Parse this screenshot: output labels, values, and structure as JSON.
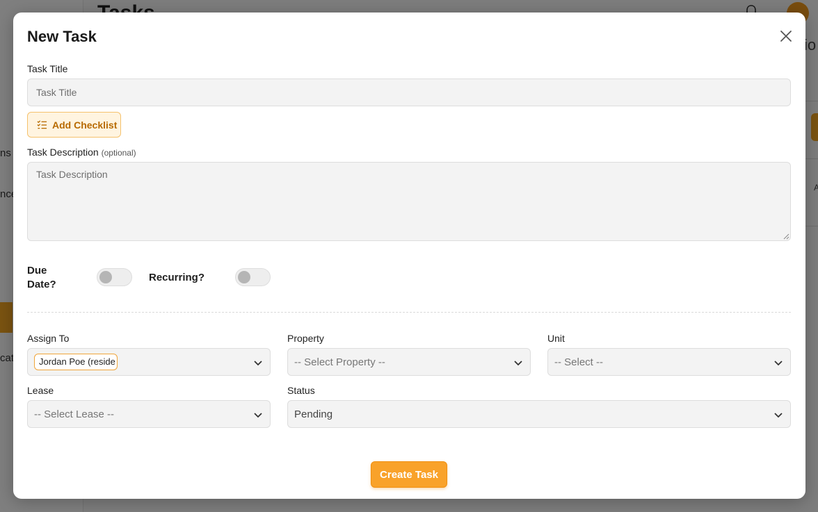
{
  "background": {
    "page_title": "Tasks",
    "nav_fragments": [
      "ns",
      "nce",
      "cat"
    ],
    "right_fragment": "io",
    "right_small": "A"
  },
  "modal": {
    "title": "New Task",
    "close_icon": "close-icon",
    "task_title": {
      "label": "Task Title",
      "placeholder": "Task Title",
      "value": ""
    },
    "add_checklist": {
      "label": "Add Checklist",
      "icon": "checklist-icon"
    },
    "task_description": {
      "label": "Task Description",
      "optional": "(optional)",
      "placeholder": "Task Description",
      "value": ""
    },
    "due_date": {
      "label_line1": "Due",
      "label_line2": "Date?",
      "enabled": false
    },
    "recurring": {
      "label": "Recurring?",
      "enabled": false
    },
    "assign_to": {
      "label": "Assign To",
      "value": "Jordan Poe (reside"
    },
    "property": {
      "label": "Property",
      "value": "-- Select Property --"
    },
    "unit": {
      "label": "Unit",
      "value": "-- Select --"
    },
    "lease": {
      "label": "Lease",
      "value": "-- Select Lease --"
    },
    "status": {
      "label": "Status",
      "value": "Pending"
    },
    "create_button": "Create Task"
  },
  "colors": {
    "accent": "#f9a22a",
    "accent_light": "#fff4e0",
    "accent_text": "#b76a00",
    "overlay": "rgba(0,0,0,0.5)"
  }
}
